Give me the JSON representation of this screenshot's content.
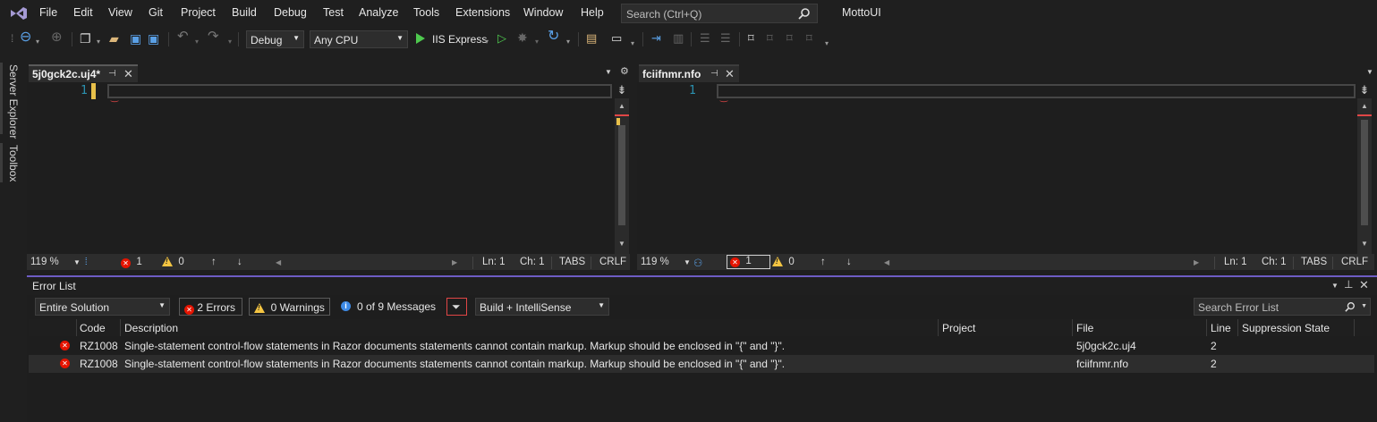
{
  "menu": [
    "File",
    "Edit",
    "View",
    "Git",
    "Project",
    "Build",
    "Debug",
    "Test",
    "Analyze",
    "Tools",
    "Extensions",
    "Window",
    "Help"
  ],
  "search": {
    "placeholder": "Search (Ctrl+Q)"
  },
  "solution_name": "MottoUI",
  "toolbar": {
    "config": "Debug",
    "platform": "Any CPU",
    "run_target": "IIS Express"
  },
  "side_tabs": [
    "Server Explorer",
    "Toolbox"
  ],
  "editors": [
    {
      "tab_name": "5j0gck2c.uj4*",
      "line_number": "1",
      "zoom": "119 %",
      "errors": "1",
      "warnings": "0",
      "ln": "Ln: 1",
      "ch": "Ch: 1",
      "indent": "TABS",
      "eol": "CRLF"
    },
    {
      "tab_name": "fciifnmr.nfo",
      "line_number": "1",
      "zoom": "119 %",
      "errors": "1",
      "warnings": "0",
      "ln": "Ln: 1",
      "ch": "Ch: 1",
      "indent": "TABS",
      "eol": "CRLF"
    }
  ],
  "error_list": {
    "title": "Error List",
    "scope": "Entire Solution",
    "errors_btn": "2 Errors",
    "warnings_btn": "0 Warnings",
    "messages_btn": "0 of 9 Messages",
    "source": "Build + IntelliSense",
    "search_placeholder": "Search Error List",
    "columns": [
      "Code",
      "Description",
      "Project",
      "File",
      "Line",
      "Suppression State"
    ],
    "rows": [
      {
        "code": "RZ1008",
        "description": "Single-statement control-flow statements in Razor documents statements cannot contain markup. Markup should be enclosed in \"{\" and \"}\".",
        "project": "",
        "file": "5j0gck2c.uj4",
        "line": "2",
        "suppression": ""
      },
      {
        "code": "RZ1008",
        "description": "Single-statement control-flow statements in Razor documents statements cannot contain markup. Markup should be enclosed in \"{\" and \"}\".",
        "project": "",
        "file": "fciifnmr.nfo",
        "line": "2",
        "suppression": ""
      }
    ]
  },
  "colors": {
    "accent": "#6d5cc4",
    "error": "#e51400",
    "warning": "#f5c542",
    "line_number": "#2b91af",
    "run_green": "#4ec94e"
  }
}
